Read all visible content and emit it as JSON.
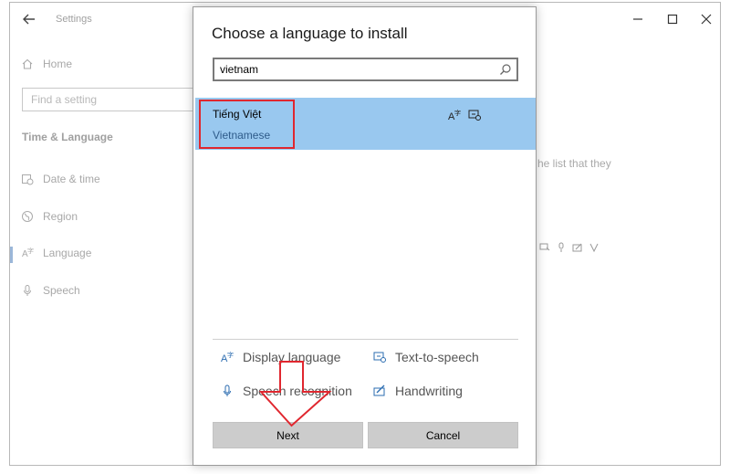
{
  "window": {
    "app_title": "Settings"
  },
  "sidebar": {
    "home_label": "Home",
    "search_placeholder": "Find a setting",
    "section_title": "Time & Language",
    "items": [
      {
        "label": "Date & time",
        "icon": "calendar-clock-icon"
      },
      {
        "label": "Region",
        "icon": "globe-icon"
      },
      {
        "label": "Language",
        "icon": "language-icon"
      },
      {
        "label": "Speech",
        "icon": "microphone-icon"
      }
    ]
  },
  "background": {
    "partial_text": "he list that they"
  },
  "dialog": {
    "title": "Choose a language to install",
    "search_value": "vietnam",
    "result": {
      "name": "Tiếng Việt",
      "subtitle": "Vietnamese"
    },
    "features": {
      "display_language": "Display language",
      "text_to_speech": "Text-to-speech",
      "speech_recognition": "Speech recognition",
      "handwriting": "Handwriting"
    },
    "next_label": "Next",
    "cancel_label": "Cancel"
  },
  "colors": {
    "selection_bg": "#99c8ef",
    "highlight_border": "#e0272f",
    "button_bg": "#cccccc"
  }
}
